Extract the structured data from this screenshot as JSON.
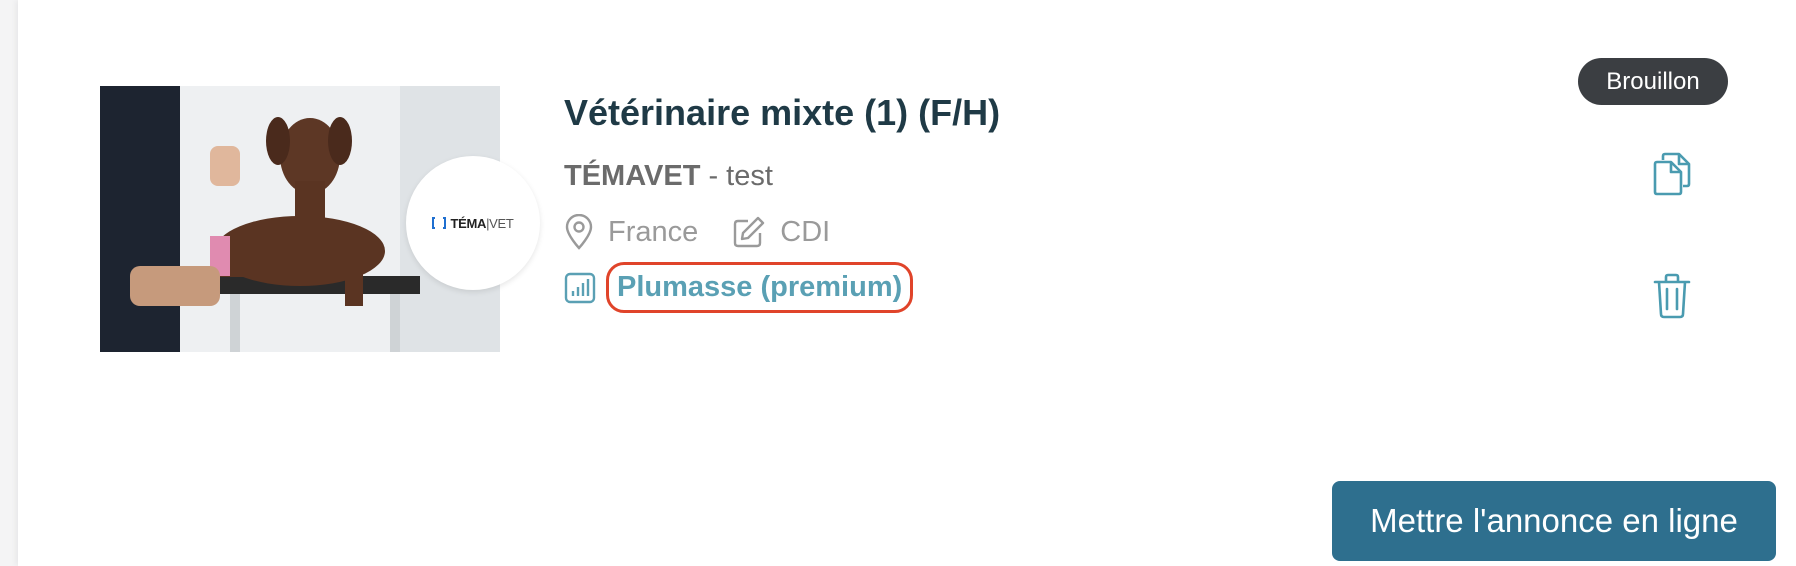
{
  "listing": {
    "title": "Vétérinaire mixte (1) (F/H)",
    "company_name": "TÉMAVET",
    "company_suffix": " - test",
    "location": "France",
    "contract": "CDI",
    "plan": "Plumasse (premium)",
    "status": "Brouillon",
    "logo": {
      "brand": "TÉMA",
      "separator": "|",
      "sub": "VET"
    }
  },
  "actions": {
    "publish_label": "Mettre l'annonce en ligne",
    "copy_icon": "copy-icon",
    "delete_icon": "trash-icon"
  },
  "colors": {
    "title": "#1f3a46",
    "accent": "#5aa0b4",
    "highlight": "#e0442a",
    "badge_bg": "#3b3e42",
    "primary_button": "#2e6f8e"
  }
}
